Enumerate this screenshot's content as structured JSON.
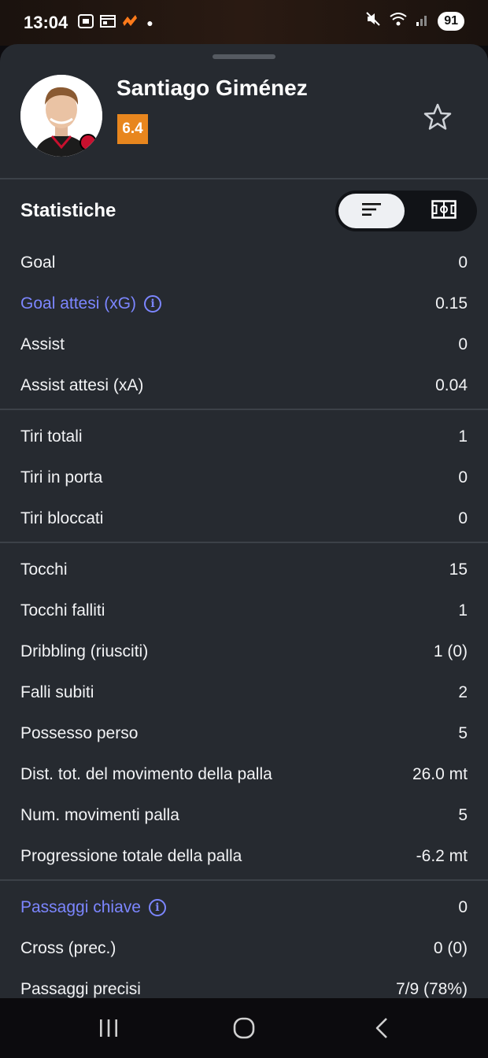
{
  "status_bar": {
    "time": "13:04",
    "battery": "91",
    "icons": [
      "screenshot-icon",
      "calendar-icon",
      "app-icon",
      "dot-icon",
      "mute-icon",
      "wifi-icon",
      "signal-icon"
    ]
  },
  "player": {
    "name": "Santiago Giménez",
    "rating": "6.4",
    "rating_color": "#e8861e",
    "favorite_icon": "star-outline-icon"
  },
  "statistics": {
    "title": "Statistiche",
    "toggle": {
      "active": "list-icon",
      "inactive": "pitch-icon"
    },
    "groups": [
      [
        {
          "label": "Goal",
          "value": "0",
          "link": false
        },
        {
          "label": "Goal attesi (xG)",
          "value": "0.15",
          "link": true
        },
        {
          "label": "Assist",
          "value": "0",
          "link": false
        },
        {
          "label": "Assist attesi (xA)",
          "value": "0.04",
          "link": false
        }
      ],
      [
        {
          "label": "Tiri totali",
          "value": "1",
          "link": false
        },
        {
          "label": "Tiri in porta",
          "value": "0",
          "link": false
        },
        {
          "label": "Tiri bloccati",
          "value": "0",
          "link": false
        }
      ],
      [
        {
          "label": "Tocchi",
          "value": "15",
          "link": false
        },
        {
          "label": "Tocchi falliti",
          "value": "1",
          "link": false
        },
        {
          "label": "Dribbling (riusciti)",
          "value": "1 (0)",
          "link": false
        },
        {
          "label": "Falli subiti",
          "value": "2",
          "link": false
        },
        {
          "label": "Possesso perso",
          "value": "5",
          "link": false
        },
        {
          "label": "Dist. tot. del movimento della palla",
          "value": "26.0 mt",
          "link": false
        },
        {
          "label": "Num. movimenti palla",
          "value": "5",
          "link": false
        },
        {
          "label": "Progressione totale della palla",
          "value": "-6.2 mt",
          "link": false
        }
      ],
      [
        {
          "label": "Passaggi chiave",
          "value": "0",
          "link": true
        },
        {
          "label": "Cross (prec.)",
          "value": "0 (0)",
          "link": false
        },
        {
          "label": "Passaggi precisi",
          "value": "7/9 (78%)",
          "link": false
        }
      ]
    ]
  },
  "colors": {
    "sheet": "#262a30",
    "link": "#7c86ff",
    "divider": "#3c4148"
  },
  "nav_bar": [
    "recent-apps-icon",
    "home-icon",
    "back-icon"
  ]
}
